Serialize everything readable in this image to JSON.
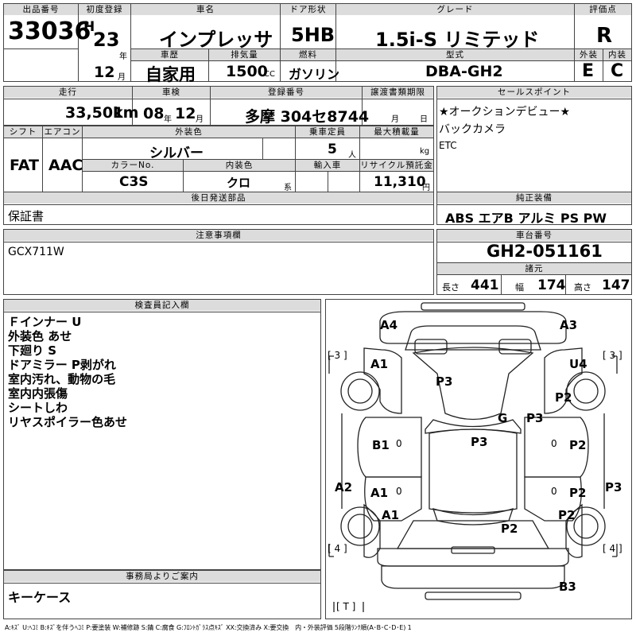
{
  "header": {
    "lot_label": "出品番号",
    "lot_number": "33036",
    "first_reg_label": "初度登録",
    "era": "H",
    "reg_year": "23",
    "year_unit": "年",
    "reg_month": "12",
    "month_unit": "月",
    "car_name_label": "車名",
    "car_name": "インプレッサ",
    "door_label": "ドア形状",
    "door": "5HB",
    "grade_label": "グレード",
    "grade": "1.5i-S リミテッド",
    "score_label": "評価点",
    "score": "R",
    "history_label": "車歴",
    "history": "自家用",
    "displacement_label": "排気量",
    "displacement": "1500",
    "cc_unit": "CC",
    "fuel_label": "燃料",
    "fuel": "ガソリン",
    "model_label": "型式",
    "model": "DBA-GH2",
    "exterior_label": "外装",
    "exterior": "E",
    "interior_label": "内装",
    "interior": "C"
  },
  "row2": {
    "mileage_label": "走行",
    "mileage": "33,501",
    "km_unit": "km",
    "inspection_label": "車検",
    "insp_year": "08",
    "insp_year_unit": "年",
    "insp_month": "12",
    "insp_month_unit": "月",
    "plate_label": "登録番号",
    "plate": "多摩 304セ8744",
    "transfer_label": "譲渡書類期限",
    "transfer_month_unit": "月",
    "transfer_day_unit": "日",
    "sales_label": "セールスポイント",
    "sales_points": [
      "★オークションデビュー★",
      "バックカメラ",
      "ETC"
    ]
  },
  "row3": {
    "shift_label": "シフト",
    "shift": "FAT",
    "ac_label": "エアコン",
    "ac": "AAC",
    "ext_color_label": "外装色",
    "ext_color": "シルバー",
    "capacity_label": "乗車定員",
    "capacity": "5",
    "capacity_unit": "人",
    "load_label": "最大積載量",
    "load_unit": "kg",
    "color_no_label": "カラーNo.",
    "color_no": "C3S",
    "int_color_label": "内装色",
    "int_color": "クロ",
    "int_color_unit": "系",
    "import_label": "輸入車",
    "recycle_label": "リサイクル預託金",
    "recycle": "11,310",
    "recycle_unit": "円"
  },
  "later_parts_label": "後日発送部品",
  "later_parts": "保証書",
  "genuine_label": "純正装備",
  "genuine": "ABS エアB アルミ PS PW",
  "notes_label": "注意事項欄",
  "notes": "GCX711W",
  "chassis_label": "車台番号",
  "chassis": "GH2-051161",
  "specs_label": "諸元",
  "dims": {
    "length_label": "長さ",
    "length": "441",
    "width_label": "幅",
    "width": "174",
    "height_label": "高さ",
    "height": "147"
  },
  "inspector_label": "検査員記入欄",
  "inspector_notes": [
    "Ｆインナー U",
    "外装色 あせ",
    "下廻り S",
    "ドアミラー P剥がれ",
    "室内汚れ、動物の毛",
    "室内内張傷",
    "シートしわ",
    "リヤスポイラー色あせ"
  ],
  "office_label": "事務局よりご案内",
  "office_note": "キーケース",
  "diagram": {
    "marks": {
      "a4": "A4",
      "a3": "A3",
      "a1_fl": "A1",
      "u4": "U4",
      "p3_hood": "P3",
      "p2_rf": "P2",
      "g": "G",
      "p3_ws": "P3",
      "b1": "B1",
      "p3_roof": "P3",
      "p2_rd1": "P2",
      "a2": "A2",
      "a1_rl": "A1",
      "p2_rd2": "P2",
      "p3_r": "P3",
      "a1_rr": "A1",
      "p2_trunk": "P2",
      "p2_rrf": "P2",
      "b3": "B3"
    },
    "tires": {
      "fl": "3",
      "fr": "3",
      "rl": "4",
      "rr": "4",
      "spare": "T"
    },
    "zeros": [
      "0",
      "0",
      "0",
      "0"
    ]
  },
  "legend": "A:ｷｽﾞ U:ﾍｺﾐ B:ｷｽﾞを伴うﾍｺﾐ P:要塗装 W:補修跡 S:錆 C:腐食 G:ﾌﾛﾝﾄｶﾞﾗｽ点ｷｽﾞ XX:交換済み X:要交換　内・外装評価 5段階ﾗﾝｸ順(A･B･C･D･E) 1"
}
